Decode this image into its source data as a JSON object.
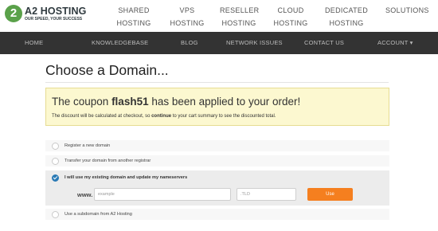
{
  "brand": {
    "mark": "2",
    "name": "A2 HOSTING",
    "tagline": "OUR SPEED, YOUR SUCCESS",
    "mark_color": "#5aa14a"
  },
  "topnav": [
    {
      "line1": "SHARED",
      "line2": "HOSTING"
    },
    {
      "line1": "VPS",
      "line2": "HOSTING"
    },
    {
      "line1": "RESELLER",
      "line2": "HOSTING"
    },
    {
      "line1": "CLOUD",
      "line2": "HOSTING"
    },
    {
      "line1": "DEDICATED",
      "line2": "HOSTING"
    },
    {
      "line1": "SOLUTIONS",
      "line2": ""
    }
  ],
  "darknav": [
    "HOME",
    "KNOWLEDGEBASE",
    "BLOG",
    "NETWORK ISSUES",
    "CONTACT US",
    "ACCOUNT ▾"
  ],
  "page": {
    "title": "Choose a Domain..."
  },
  "coupon": {
    "prefix": "The coupon ",
    "code": "flash51",
    "suffix": " has been applied to your order!",
    "note_prefix": "The discount will be calculated at checkout, so ",
    "note_bold": "continue",
    "note_suffix": " to your cart summary to see the discounted total."
  },
  "options": [
    {
      "label": "Register a new domain",
      "selected": false
    },
    {
      "label": "Transfer your domain from another registrar",
      "selected": false
    },
    {
      "label": "I will use my existing domain and update my nameservers",
      "selected": true
    },
    {
      "label": "Use a subdomain from A2 Hosting",
      "selected": false
    }
  ],
  "existing_domain": {
    "prefix": "www.",
    "domain_placeholder": "example",
    "domain_value": "",
    "tld_placeholder": ".TLD",
    "tld_value": "",
    "button_label": "Use"
  },
  "colors": {
    "accent_button": "#f57f1f",
    "selected_radio": "#2a7ab5",
    "coupon_bg": "#fcf8d0",
    "nav_bg": "#333333"
  }
}
